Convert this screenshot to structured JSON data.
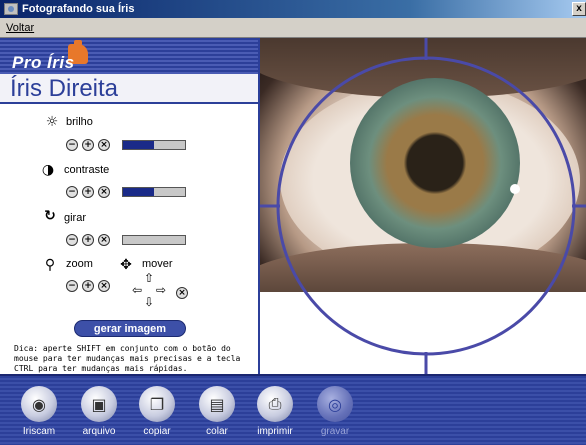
{
  "window": {
    "title": "Fotografando sua Íris",
    "close_label": "x"
  },
  "menu": {
    "items": [
      "Voltar"
    ]
  },
  "brand": {
    "logo_text": "Pro Íris"
  },
  "panel": {
    "title": "Íris Direita",
    "controls": {
      "brilho": {
        "label": "brilho",
        "level": 0.5
      },
      "contraste": {
        "label": "contraste",
        "level": 0.5
      },
      "girar": {
        "label": "girar",
        "level": 0.0
      },
      "zoom": {
        "label": "zoom"
      },
      "mover": {
        "label": "mover"
      }
    },
    "glyphs": {
      "minus": "−",
      "plus": "+",
      "reset": "×"
    },
    "generate_button": "gerar imagem",
    "tip": "Dica: aperte SHIFT em conjunto com o botão do mouse para ter mudanças mais precisas e a tecla CTRL para ter mudanças mais rápidas."
  },
  "toolbar": {
    "buttons": [
      {
        "label": "Iriscam",
        "icon": "camera-icon",
        "enabled": true
      },
      {
        "label": "arquivo",
        "icon": "floppy-disk-icon",
        "enabled": true
      },
      {
        "label": "copiar",
        "icon": "copy-icon",
        "enabled": true
      },
      {
        "label": "colar",
        "icon": "paste-icon",
        "enabled": true
      },
      {
        "label": "imprimir",
        "icon": "printer-icon",
        "enabled": true
      },
      {
        "label": "gravar",
        "icon": "cd-burn-icon",
        "enabled": false
      }
    ]
  },
  "colors": {
    "brand_blue": "#2c3f99",
    "accent_orange": "#e8782a",
    "bar_fill": "#1a2a88"
  }
}
